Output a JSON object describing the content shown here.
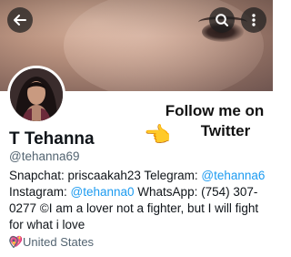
{
  "header": {
    "back_icon": "arrow-left-icon",
    "search_icon": "search-icon",
    "more_icon": "more-vertical-icon"
  },
  "banner": {
    "promo_line1": "Follow me on",
    "promo_line2": "Twitter",
    "pointer_emoji": "👈"
  },
  "profile": {
    "display_name": "T Tehanna",
    "handle": "@tehanna69",
    "bio": {
      "snapchat_label": "Snapchat: priscaakah23 Telegram: ",
      "telegram_handle": "@tehanna6",
      "instagram_label": "Instagram: ",
      "instagram_handle": "@tehanna0",
      "whatsapp_text": " WhatsApp: (754) 307-0277 ©I am a lover not a fighter, but I will fight for what i love",
      "heart_emoji": "💖"
    },
    "location": "United States"
  },
  "colors": {
    "link": "#1d9bf0",
    "secondary_text": "#536471",
    "primary_text": "#0f1419"
  }
}
